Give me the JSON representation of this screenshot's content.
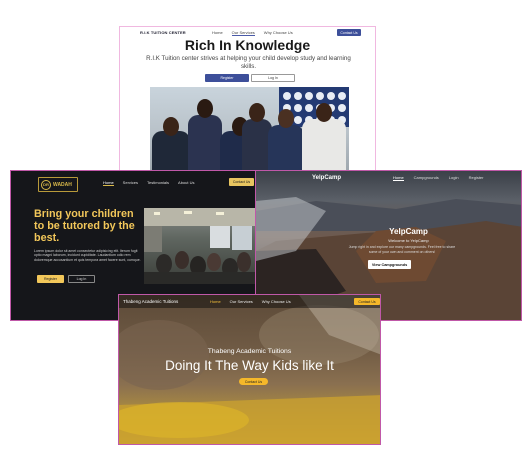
{
  "rik": {
    "brand": "R.I.K TUITION CENTER",
    "nav": [
      "Home",
      "Our Services",
      "Why Choose Us"
    ],
    "contact": "Contact Us",
    "title": "Rich In Knowledge",
    "subtitle": "R.I.K Tuition center strives at helping your child develop study and learning skills.",
    "register": "Register",
    "login": "Log In"
  },
  "dr": {
    "logo_mark": "DR",
    "logo_text": "WADAH",
    "nav": [
      "Home",
      "Services",
      "Testimonials",
      "About Us"
    ],
    "contact": "Contact Us",
    "headline": "Bring your children to be tutored by the best.",
    "body": "Lorem ipsum dolor sit amet consectetur adipisicing elit. Iterum fugit optio magni laborum, incidunt cupiditate. Laudantium odio rem doloremque accusantium et quis tempora amet facere sunt, cumque.",
    "register": "Register",
    "login": "Log In"
  },
  "yelp": {
    "brand": "YelpCamp",
    "nav": [
      "Home",
      "Campgrounds",
      "Login",
      "Register"
    ],
    "title": "YelpCamp",
    "welcome": "Welcome to YelpCamp",
    "desc": "Jump right in and explore our many campgrounds. Feel free to share some of your own and comment on others!",
    "button": "View Campgrounds"
  },
  "thabeng": {
    "brand": "Thabeng Academic Tuitions",
    "nav": [
      "Home",
      "Our Services",
      "Why Choose Us"
    ],
    "contact": "Contact Us",
    "subtitle": "Thabeng Academic Tuitions",
    "title": "Doing It The Way Kids like It",
    "button": "Contact Us"
  }
}
